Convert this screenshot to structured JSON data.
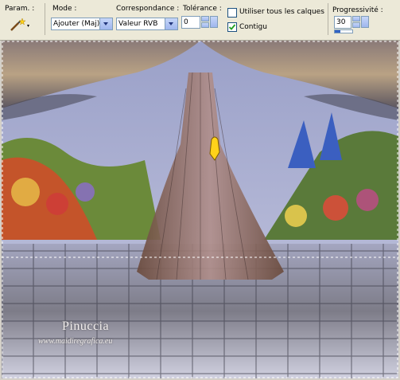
{
  "toolbar": {
    "param_label": "Param. :",
    "mode_label": "Mode :",
    "mode_value": "Ajouter (Maj)",
    "match_label": "Correspondance :",
    "match_value": "Valeur RVB",
    "tolerance_label": "Tolérance :",
    "tolerance_value": "0",
    "all_layers_label": "Utiliser tous les calques",
    "all_layers_checked": false,
    "contiguous_label": "Contigu",
    "contiguous_checked": true,
    "feather_label": "Progressivité :",
    "feather_value": "30"
  },
  "canvas": {
    "watermark_name": "Pinuccia",
    "watermark_url": "www.maidiregrafica.eu"
  },
  "colors": {
    "toolbar_bg": "#ece9d8",
    "combo_border": "#7f9db9",
    "check_green": "#21a121"
  }
}
